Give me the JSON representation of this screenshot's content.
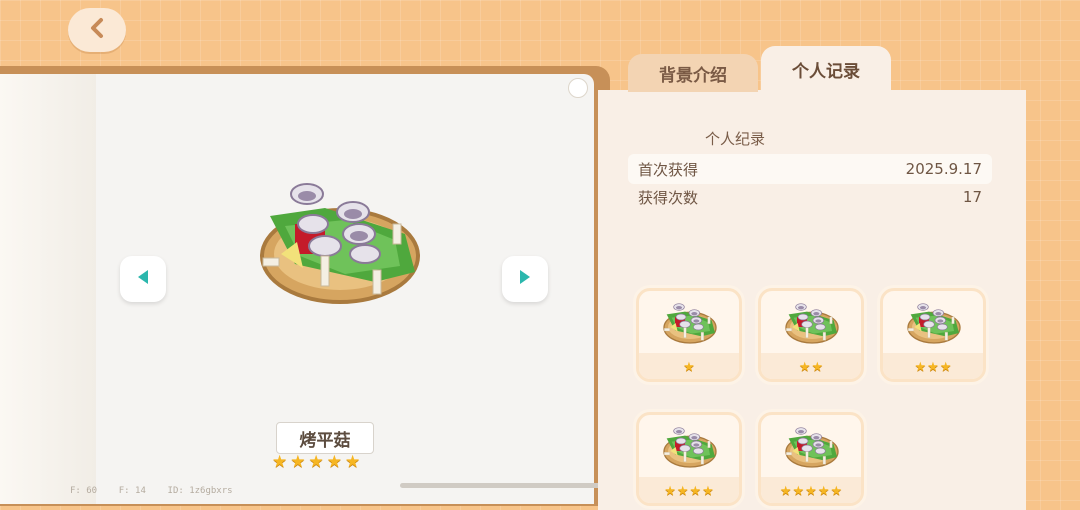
{
  "tabs": [
    {
      "label": "背景介绍",
      "active": false
    },
    {
      "label": "个人记录",
      "active": true
    }
  ],
  "record": {
    "title": "个人纪录",
    "rows": [
      {
        "label": "首次获得",
        "value": "2025.9.17"
      },
      {
        "label": "获得次数",
        "value": "17"
      }
    ]
  },
  "item": {
    "name": "烤平菇",
    "stars": 5
  },
  "variants": [
    {
      "stars": 1
    },
    {
      "stars": 2
    },
    {
      "stars": 3
    },
    {
      "stars": 4
    },
    {
      "stars": 5
    }
  ],
  "debug_text": "F: 60    F: 14    ID: 1z6gbxrs",
  "icons": {
    "back": "chevron-left-icon",
    "prev": "triangle-left-icon",
    "next": "triangle-right-icon",
    "star": "star-icon"
  },
  "colors": {
    "background": "#f7c48a",
    "accent_teal": "#2bb7ad",
    "star": "#f6b623",
    "text_brown": "#6f5644"
  }
}
